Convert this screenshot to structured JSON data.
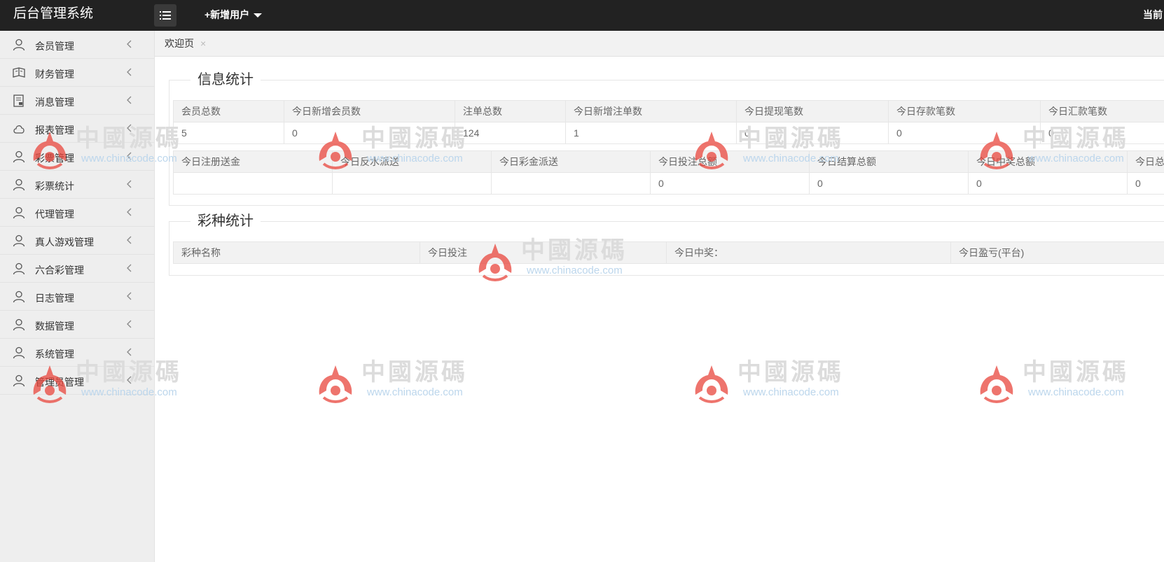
{
  "header": {
    "title": "后台管理系统",
    "add_user_label": "+新增用户",
    "current_user_label": "当前"
  },
  "sidebar": {
    "items": [
      {
        "label": "会员管理",
        "icon": "user-icon"
      },
      {
        "label": "财务管理",
        "icon": "book-icon"
      },
      {
        "label": "消息管理",
        "icon": "document-icon"
      },
      {
        "label": "报表管理",
        "icon": "cloud-icon"
      },
      {
        "label": "彩票管理",
        "icon": "user-icon"
      },
      {
        "label": "彩票统计",
        "icon": "user-icon"
      },
      {
        "label": "代理管理",
        "icon": "user-icon"
      },
      {
        "label": "真人游戏管理",
        "icon": "user-icon"
      },
      {
        "label": "六合彩管理",
        "icon": "user-icon"
      },
      {
        "label": "日志管理",
        "icon": "user-icon"
      },
      {
        "label": "数据管理",
        "icon": "user-icon"
      },
      {
        "label": "系统管理",
        "icon": "user-icon"
      },
      {
        "label": "管理员管理",
        "icon": "user-icon"
      }
    ]
  },
  "tabs": [
    {
      "label": "欢迎页",
      "close": "×"
    }
  ],
  "info_stats": {
    "title": "信息统计",
    "table1": {
      "headers": [
        "会员总数",
        "今日新增会员数",
        "注单总数",
        "今日新增注单数",
        "今日提现笔数",
        "今日存款笔数",
        "今日汇款笔数"
      ],
      "values": [
        "5",
        "0",
        "124",
        "1",
        "0",
        "0",
        "0"
      ]
    },
    "table2": {
      "headers": [
        "今日注册送金",
        "今日反水派送",
        "今日彩金派送",
        "今日投注总额",
        "今日结算总额",
        "今日中奖总额",
        "今日总"
      ],
      "values": [
        "",
        "",
        "",
        "0",
        "0",
        "0",
        "0"
      ]
    }
  },
  "lottery_stats": {
    "title": "彩种统计",
    "headers": [
      "彩种名称",
      "今日投注",
      "今日中奖：",
      "今日盈亏(平台)"
    ]
  },
  "watermark": {
    "text": "中國源碼",
    "url": "www.chinacode.com"
  },
  "colors": {
    "header_bg": "#222222",
    "sidebar_bg": "#eeeeee",
    "table_head_bg": "#f2f2f2",
    "watermark_red": "#e8453c"
  }
}
